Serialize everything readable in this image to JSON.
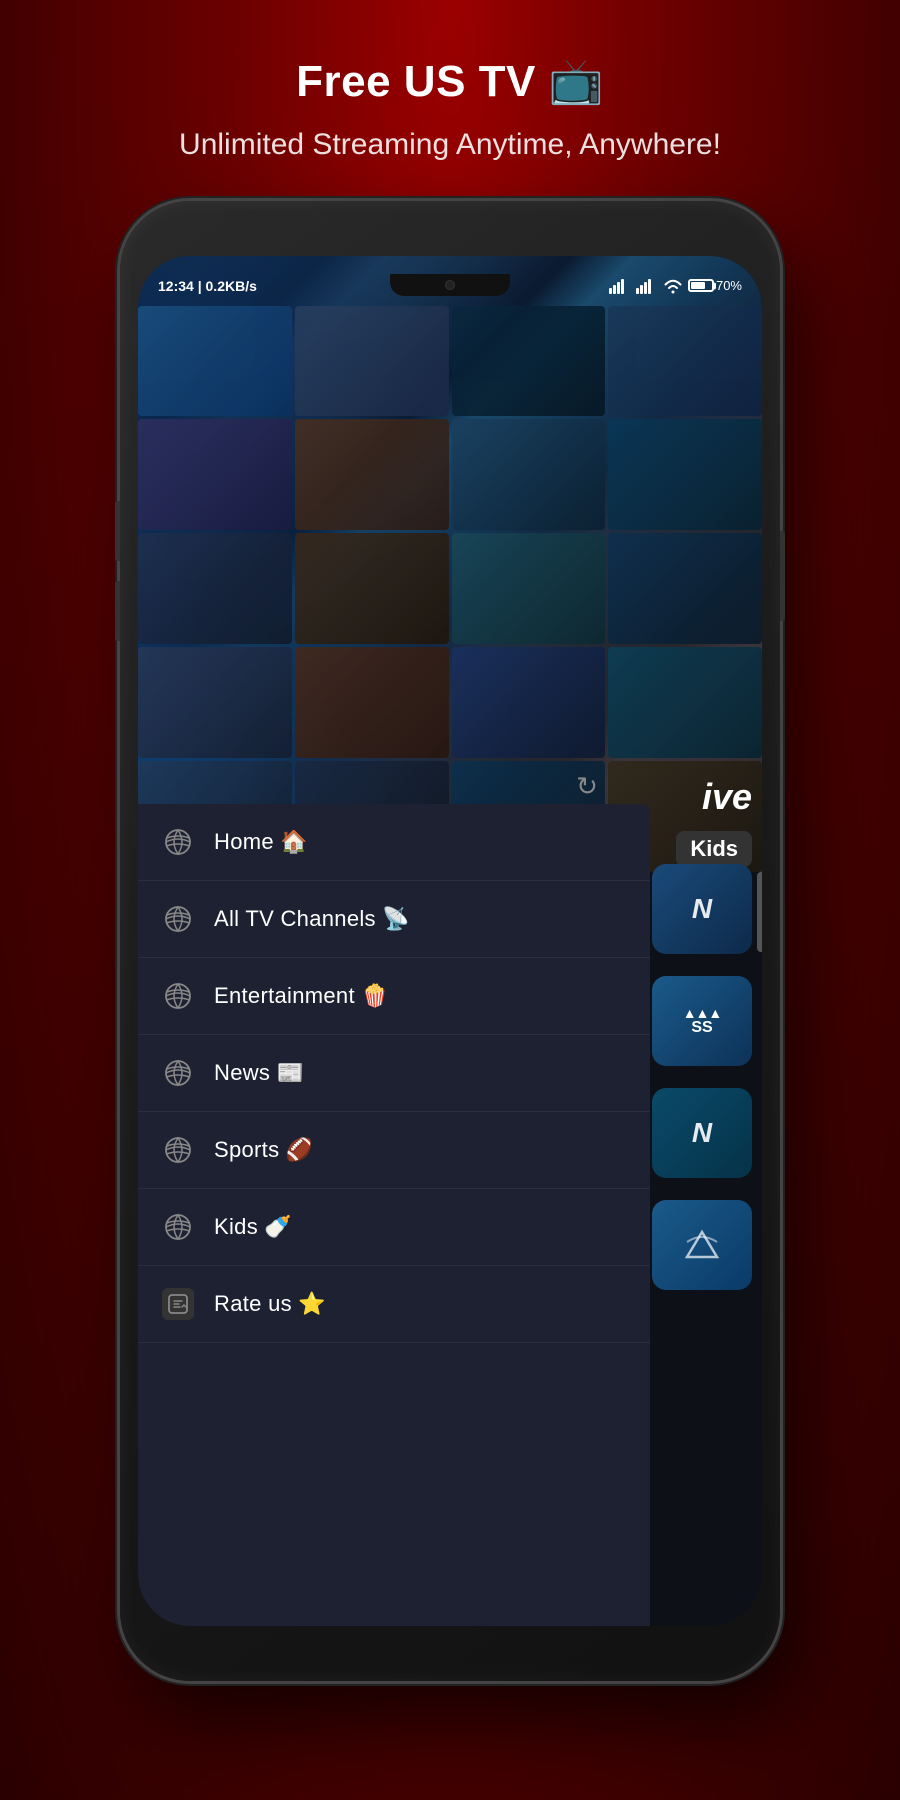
{
  "header": {
    "title": "Free US TV 📺",
    "subtitle": "Unlimited Streaming Anytime, Anywhere!"
  },
  "status_bar": {
    "time": "12:34",
    "speed": "0.2KB/s",
    "battery": "70%",
    "battery_icon": "🔋",
    "wifi_icon": "WiFi",
    "signal": "Signal"
  },
  "app": {
    "live_label": "ive",
    "kids_tag": "Kids",
    "refresh_icon": "↻"
  },
  "nav_drawer": {
    "items": [
      {
        "id": "home",
        "label": "Home 🏠",
        "icon_type": "globe"
      },
      {
        "id": "all-tv",
        "label": "All TV Channels 📡",
        "icon_type": "globe"
      },
      {
        "id": "entertainment",
        "label": "Entertainment 🍿",
        "icon_type": "globe"
      },
      {
        "id": "news",
        "label": "News 📰",
        "icon_type": "globe"
      },
      {
        "id": "sports",
        "label": "Sports 🏈",
        "icon_type": "globe"
      },
      {
        "id": "kids",
        "label": "Kids 🍼",
        "icon_type": "globe"
      },
      {
        "id": "rate",
        "label": "Rate us ⭐",
        "icon_type": "rate"
      }
    ]
  },
  "channel_icons": [
    {
      "id": "ch1",
      "letter": "N",
      "color": "blue"
    },
    {
      "id": "ch2",
      "letter": "SS",
      "color": "adidas"
    },
    {
      "id": "ch3",
      "letter": "N",
      "color": "teal"
    },
    {
      "id": "ch4",
      "letter": "",
      "color": "cyan"
    }
  ]
}
